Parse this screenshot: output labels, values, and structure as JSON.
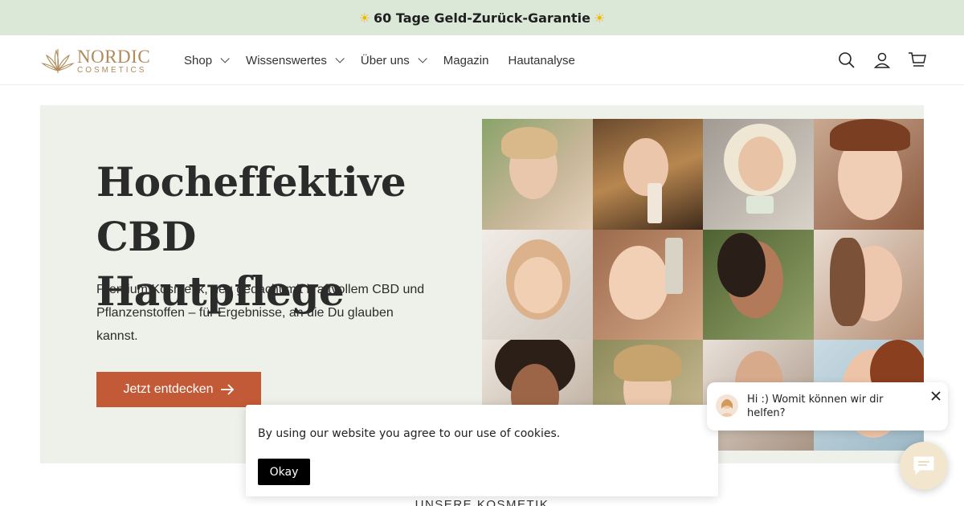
{
  "announcement": {
    "icon_left": "sun-emoji",
    "text": "60 Tage Geld-Zurück-Garantie",
    "icon_right": "sun-emoji"
  },
  "header": {
    "logo": {
      "word1": "NORDIC",
      "word2": "COSMETICS",
      "color": "#b08a5a"
    },
    "nav": [
      {
        "label": "Shop",
        "has_dropdown": true
      },
      {
        "label": "Wissenswertes",
        "has_dropdown": true
      },
      {
        "label": "Über uns",
        "has_dropdown": true
      },
      {
        "label": "Magazin",
        "has_dropdown": false
      },
      {
        "label": "Hautanalyse",
        "has_dropdown": false
      }
    ],
    "icons": [
      "search-icon",
      "account-icon",
      "cart-icon"
    ]
  },
  "hero": {
    "title_line1": "Hocheffektive",
    "title_line2": "CBD Hautpflege",
    "description": "Premium Kosmetik, neu gedacht mit kraftvollem CBD und Pflanzenstoffen – für Ergebnisse, an die Du glauben kannst.",
    "cta_label": "Jetzt entdecken",
    "background": "#eef1e9",
    "cta_color": "#c25a37"
  },
  "cookie_banner": {
    "message": "By using our website you agree to our use of cookies.",
    "button_label": "Okay"
  },
  "chat": {
    "popup_text": "Hi :) Womit können wir dir helfen?",
    "icons": [
      "close-icon",
      "chat-bubble-icon"
    ]
  },
  "next_section": {
    "title": "UNSERE KOSMETIK"
  }
}
